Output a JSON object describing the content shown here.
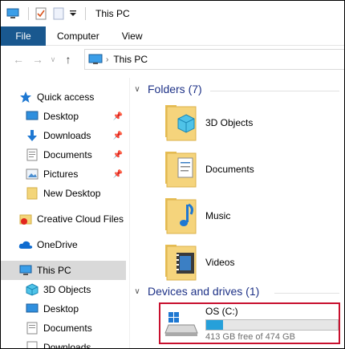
{
  "window": {
    "title": "This PC"
  },
  "ribbon": {
    "tabs": [
      "File",
      "Computer",
      "View"
    ]
  },
  "address": {
    "location": "This PC"
  },
  "nav": {
    "quick_access": "Quick access",
    "items": [
      {
        "label": "Desktop",
        "pinned": true
      },
      {
        "label": "Downloads",
        "pinned": true
      },
      {
        "label": "Documents",
        "pinned": true
      },
      {
        "label": "Pictures",
        "pinned": true
      },
      {
        "label": "New Desktop",
        "pinned": false
      }
    ],
    "creative_cloud": "Creative Cloud Files",
    "onedrive": "OneDrive",
    "this_pc": "This PC",
    "pc_children": [
      "3D Objects",
      "Desktop",
      "Documents",
      "Downloads"
    ]
  },
  "content": {
    "folders_header": "Folders (7)",
    "folders": [
      "3D Objects",
      "Documents",
      "Music",
      "Videos"
    ],
    "drives_header": "Devices and drives (1)",
    "drive": {
      "name": "OS (C:)",
      "free_text": "413 GB free of 474 GB",
      "used_fraction": 0.13
    }
  },
  "colors": {
    "file_tab": "#19588f",
    "header_text": "#1e3287",
    "selection": "#d9d9d9",
    "highlight_border": "#c8102e",
    "drive_bar": "#26a0da"
  }
}
